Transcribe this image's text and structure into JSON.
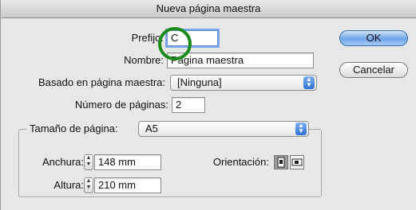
{
  "window": {
    "title": "Nueva página maestra"
  },
  "form": {
    "prefix_label": "Prefijo:",
    "prefix_value": "C",
    "name_label": "Nombre:",
    "name_value": "Página maestra",
    "based_on_label": "Basado en página maestra:",
    "based_on_value": "[Ninguna]",
    "pages_label": "Número de páginas:",
    "pages_value": "2"
  },
  "page_size": {
    "label": "Tamaño de página:",
    "value": "A5",
    "width_label": "Anchura:",
    "width_value": "148 mm",
    "height_label": "Altura:",
    "height_value": "210 mm",
    "orientation_label": "Orientación:",
    "orientation_selected": "portrait"
  },
  "buttons": {
    "ok": "OK",
    "cancel": "Cancelar"
  },
  "colors": {
    "annotation_circle": "#1a8a1a",
    "default_button": "#6ea4ea"
  },
  "icons": [
    "chevron-updown-icon",
    "stepper-icon",
    "portrait-orientation-icon",
    "landscape-orientation-icon"
  ]
}
